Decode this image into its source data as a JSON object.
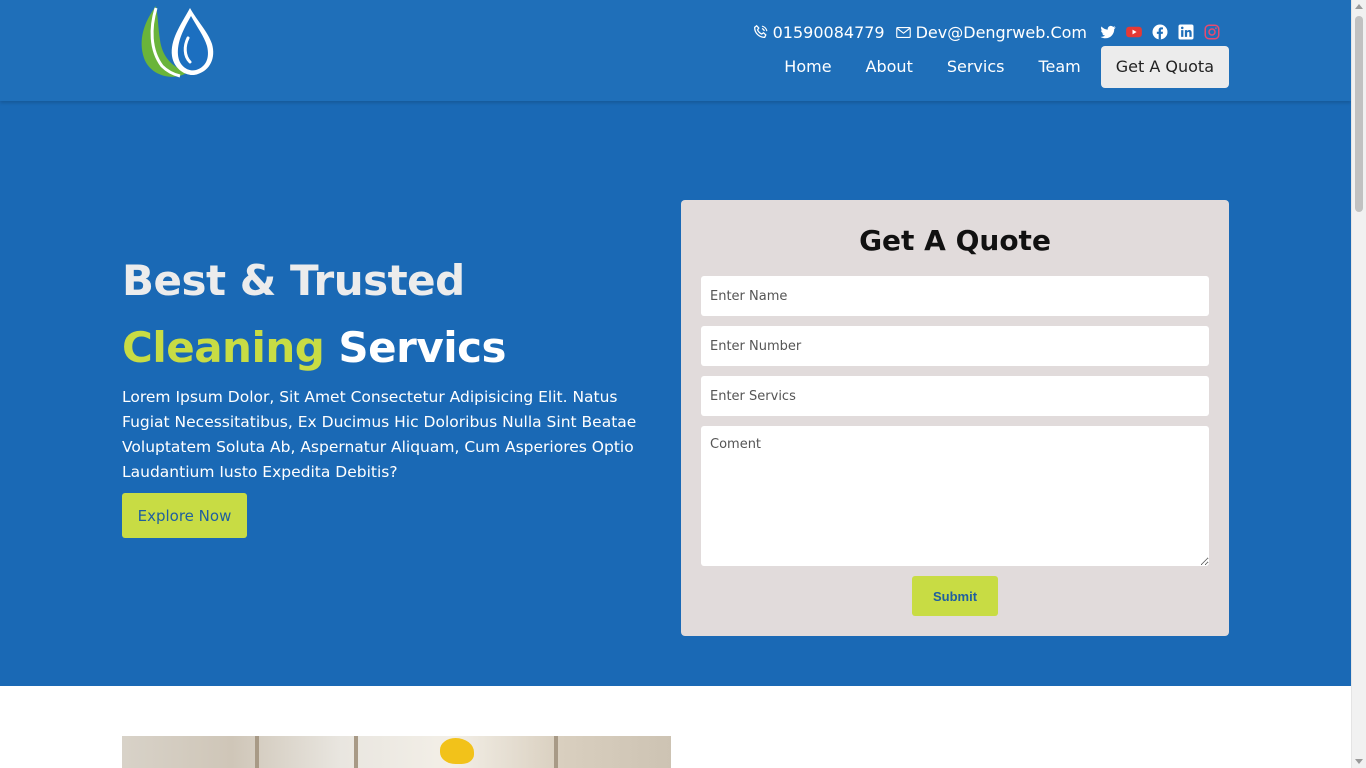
{
  "header": {
    "phone": "01590084779",
    "email": "Dev@Dengrweb.Com",
    "social_icons": [
      "twitter-icon",
      "youtube-icon",
      "facebook-icon",
      "linkedin-icon",
      "instagram-icon"
    ],
    "nav": [
      {
        "label": "Home"
      },
      {
        "label": "About"
      },
      {
        "label": "Servics"
      },
      {
        "label": "Team"
      }
    ],
    "cta_label": "Get A Quota"
  },
  "hero": {
    "title_line1": "Best & Trusted",
    "title_accent": "Cleaning",
    "title_rest": " Servics",
    "body": "Lorem Ipsum Dolor, Sit Amet Consectetur Adipisicing Elit. Natus Fugiat Necessitatibus, Ex Ducimus Hic Doloribus Nulla Sint Beatae Voluptatem Soluta Ab, Aspernatur Aliquam, Cum Asperiores Optio Laudantium Iusto Expedita Debitis?",
    "button_label": "Explore Now"
  },
  "quote_form": {
    "title": "Get A Quote",
    "name_placeholder": "Enter Name",
    "number_placeholder": "Enter Number",
    "service_placeholder": "Enter Servics",
    "comment_placeholder": "Coment",
    "submit_label": "Submit"
  },
  "colors": {
    "header_bg": "#1f6fb9",
    "hero_bg": "#1a69b5",
    "accent": "#c8dc44",
    "form_bg": "#e1dbdb"
  }
}
